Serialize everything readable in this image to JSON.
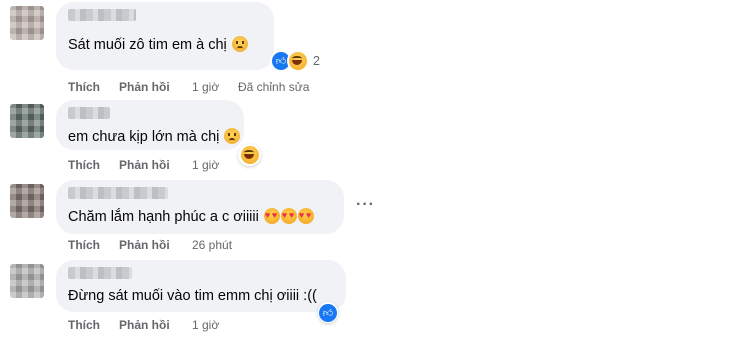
{
  "comments": [
    {
      "text": "Sát muối zô tim em à chị",
      "actions": {
        "like": "Thích",
        "reply": "Phản hồi",
        "time": "1 giờ",
        "edited": "Đã chỉnh sửa"
      },
      "reactions": {
        "types": [
          "like-icon",
          "laughing-emoji-icon"
        ],
        "count": "2"
      },
      "emoji": "crying-emoji-icon"
    },
    {
      "text": "em chưa kịp lớn mà chị",
      "actions": {
        "like": "Thích",
        "reply": "Phản hồi",
        "time": "1 giờ"
      },
      "reactions": {
        "types": [
          "laughing-emoji-icon"
        ]
      },
      "emoji": "sad-emoji-icon"
    },
    {
      "text": "Chăm lắm hạnh phúc a c ơiiiii",
      "actions": {
        "like": "Thích",
        "reply": "Phản hồi",
        "time": "26 phút"
      },
      "emoji": "heart-face-emoji-icon"
    },
    {
      "text": "Đừng sát muối vào tim emm chị ơiiii :((",
      "actions": {
        "like": "Thích",
        "reply": "Phản hồi",
        "time": "1 giờ"
      },
      "reactions": {
        "types": [
          "like-icon"
        ]
      }
    }
  ],
  "colors": {
    "bubble": "#f0f2f5",
    "meta": "#65676b",
    "like_blue": "#1877f2",
    "text": "#050505"
  },
  "more_menu": "more-options-icon"
}
